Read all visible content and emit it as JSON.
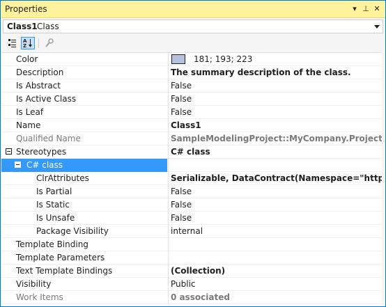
{
  "window": {
    "title": "Properties",
    "controls": {
      "dropdown": "▾",
      "pin": "⊥",
      "close": "✕"
    }
  },
  "object_selector": {
    "name": "Class1",
    "type": "Class"
  },
  "toolbar": {
    "categorized_icon": "categorized-icon",
    "alphabetical_icon": "alphabetical-icon",
    "property_pages_icon": "wrench-icon"
  },
  "properties": [
    {
      "name": "Color",
      "value": "181; 193; 223",
      "swatch": "#b5c1df"
    },
    {
      "name": "Description",
      "value": "The summary description of the class.",
      "bold": true
    },
    {
      "name": "Is Abstract",
      "value": "False"
    },
    {
      "name": "Is Active Class",
      "value": "False"
    },
    {
      "name": "Is Leaf",
      "value": "False"
    },
    {
      "name": "Name",
      "value": "Class1",
      "bold": true
    },
    {
      "name": "Qualified Name",
      "value": "SampleModelingProject::MyCompany.ProjectNamespace",
      "disabled": true,
      "bold": true
    },
    {
      "name": "Stereotypes",
      "value": "C# class",
      "bold": true,
      "expander": true
    },
    {
      "name": "C# class",
      "value": "",
      "selected": true,
      "expander": true,
      "indent": 1
    },
    {
      "name": "ClrAttributes",
      "value": "Serializable, DataContract(Namespace=\"http://alegri.eu",
      "bold": true,
      "indent": 2
    },
    {
      "name": "Is Partial",
      "value": "False",
      "indent": 2
    },
    {
      "name": "Is Static",
      "value": "False",
      "indent": 2
    },
    {
      "name": "Is Unsafe",
      "value": "False",
      "indent": 2
    },
    {
      "name": "Package Visibility",
      "value": "internal",
      "indent": 2
    },
    {
      "name": "Template Binding",
      "value": ""
    },
    {
      "name": "Template Parameters",
      "value": ""
    },
    {
      "name": "Text Template Bindings",
      "value": "(Collection)",
      "bold": true
    },
    {
      "name": "Visibility",
      "value": "Public"
    },
    {
      "name": "Work Items",
      "value": "0 associated",
      "disabled": true,
      "bold": true
    }
  ],
  "colors": {
    "titlebar": "#fff29d",
    "selection": "#3399ff",
    "border": "#007acc"
  }
}
